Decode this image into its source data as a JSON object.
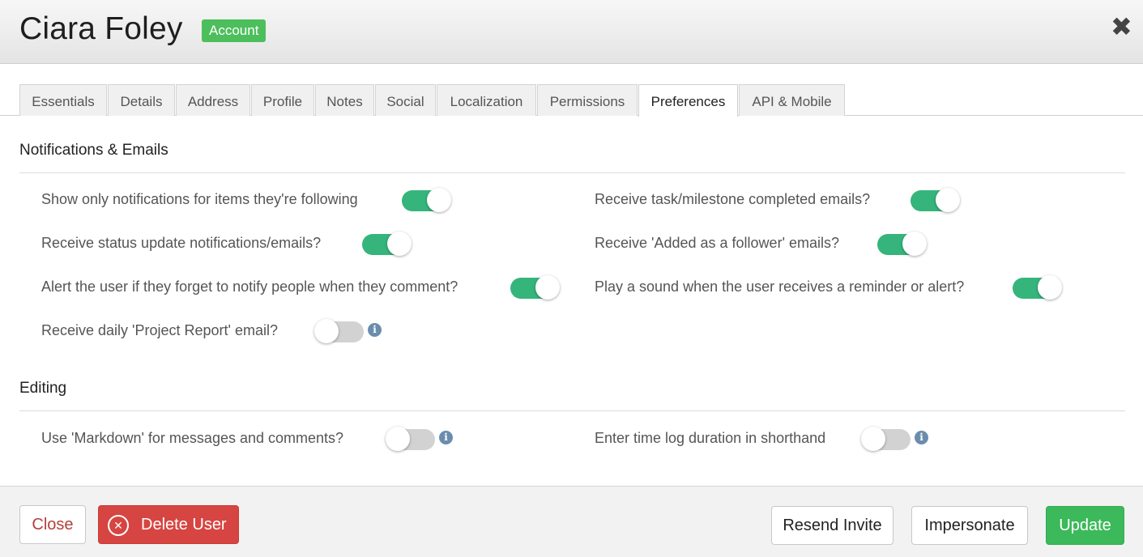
{
  "header": {
    "title": "Ciara Foley",
    "badge": "Account",
    "close_icon": "close-x-icon"
  },
  "tabs": [
    {
      "label": "Essentials",
      "active": false
    },
    {
      "label": "Details",
      "active": false
    },
    {
      "label": "Address",
      "active": false
    },
    {
      "label": "Profile",
      "active": false
    },
    {
      "label": "Notes",
      "active": false
    },
    {
      "label": "Social",
      "active": false
    },
    {
      "label": "Localization",
      "active": false
    },
    {
      "label": "Permissions",
      "active": false
    },
    {
      "label": "Preferences",
      "active": true
    },
    {
      "label": "API & Mobile",
      "active": false
    }
  ],
  "notifications": {
    "title": "Notifications & Emails",
    "options": [
      {
        "label": "Show only notifications for items they're following",
        "enabled": true
      },
      {
        "label": "Receive task/milestone completed emails?",
        "enabled": true
      },
      {
        "label": "Receive status update notifications/emails?",
        "enabled": true
      },
      {
        "label": "Receive 'Added as a follower' emails?",
        "enabled": true
      },
      {
        "label": "Alert the user if they forget to notify people when they comment?",
        "enabled": true
      },
      {
        "label": "Play a sound when the user receives a reminder or alert?",
        "enabled": true
      },
      {
        "label": "Receive daily 'Project Report' email?",
        "enabled": false,
        "info_icon": "info-icon"
      }
    ]
  },
  "editing": {
    "title": "Editing",
    "options": [
      {
        "label": "Use 'Markdown' for messages and comments?",
        "enabled": false,
        "info_icon": "info-icon"
      },
      {
        "label": "Enter time log duration in shorthand",
        "enabled": false,
        "info_icon": "info-icon"
      }
    ]
  },
  "footer": {
    "close_label": "Close",
    "delete_label": "Delete User",
    "resend_label": "Resend Invite",
    "impersonate_label": "Impersonate",
    "update_label": "Update"
  },
  "colors": {
    "toggle_on": "#35b57b",
    "toggle_off": "#d2d2d2",
    "badge": "#4cbf5c",
    "delete": "#d64541",
    "update": "#3cb95a"
  }
}
